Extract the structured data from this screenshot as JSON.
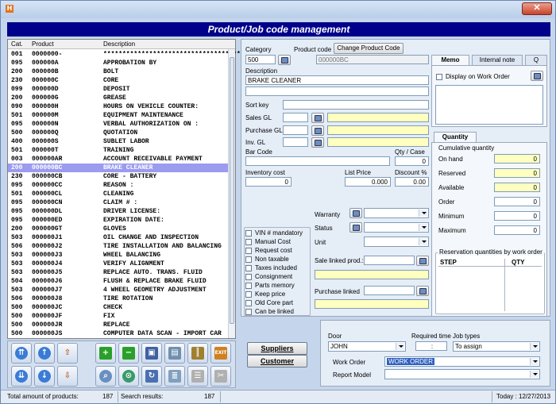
{
  "window": {
    "title": "",
    "close_glyph": "✕",
    "app_icon": "H"
  },
  "header": {
    "title": "Product/Job code management"
  },
  "list": {
    "columns": [
      "Cat.",
      "Product",
      "Description"
    ],
    "rows": [
      [
        "001",
        "0000000-",
        "**************************************"
      ],
      [
        "095",
        "000000A",
        "APPROBATION BY"
      ],
      [
        "200",
        "000000B",
        "BOLT"
      ],
      [
        "230",
        "000000C",
        "CORE"
      ],
      [
        "099",
        "000000D",
        "DEPOSIT"
      ],
      [
        "200",
        "000000G",
        "GREASE"
      ],
      [
        "090",
        "000000H",
        "HOURS ON VEHICLE COUNTER:"
      ],
      [
        "501",
        "000000M",
        "EQUIPMENT MAINTENANCE"
      ],
      [
        "095",
        "000000N",
        "VERBAL AUTHORIZATION ON :"
      ],
      [
        "500",
        "000000Q",
        "QUOTATION"
      ],
      [
        "400",
        "000000S",
        "SUBLET LABOR"
      ],
      [
        "501",
        "000000T",
        "TRAINING"
      ],
      [
        "003",
        "000000AR",
        "ACCOUNT RECEIVABLE PAYMENT"
      ],
      [
        "200",
        "000000BC",
        "BRAKE CLEANER"
      ],
      [
        "230",
        "000000CB",
        "CORE - BATTERY"
      ],
      [
        "095",
        "000000CC",
        "REASON :"
      ],
      [
        "501",
        "000000CL",
        "CLEANING"
      ],
      [
        "095",
        "000000CN",
        "CLAIM # :"
      ],
      [
        "095",
        "000000DL",
        "DRIVER LICENSE:"
      ],
      [
        "095",
        "000000ED",
        "EXPIRATION DATE:"
      ],
      [
        "200",
        "000000GT",
        "GLOVES"
      ],
      [
        "503",
        "000000J1",
        "OIL CHANGE AND INSPECTION"
      ],
      [
        "506",
        "000000J2",
        "TIRE INSTALLATION AND BALANCING"
      ],
      [
        "503",
        "000000J3",
        "WHEEL BALANCING"
      ],
      [
        "503",
        "000000J4",
        "VERIFY ALIGNMENT"
      ],
      [
        "503",
        "000000J5",
        "REPLACE AUTO. TRANS. FLUID"
      ],
      [
        "504",
        "000000J6",
        "FLUSH & REPLACE BRAKE FLUID"
      ],
      [
        "503",
        "000000J7",
        "4 WHEEL GEOMETRY ADJUSTMENT"
      ],
      [
        "506",
        "000000J8",
        "TIRE ROTATION"
      ],
      [
        "500",
        "000000JC",
        "CHECK"
      ],
      [
        "500",
        "000000JF",
        "FIX"
      ],
      [
        "500",
        "000000JR",
        "REPLACE"
      ],
      [
        "500",
        "000000JS",
        "COMPUTER DATA SCAN - IMPORT CAR"
      ]
    ],
    "selected_index": 13
  },
  "form": {
    "category_label": "Category",
    "category_value": "500",
    "product_code_label": "Product code",
    "product_code_value": "000000BC",
    "change_code_button": "Change Product Code",
    "description_label": "Description",
    "description_value": "BRAKE CLEANER",
    "sort_key_label": "Sort key",
    "sales_gl_label": "Sales GL",
    "purchase_gl_label": "Purchase GL",
    "inv_gl_label": "Inv. GL",
    "barcode_label": "Bar Code",
    "qty_case_label": "Qty / Case",
    "qty_case_value": "0",
    "inventory_cost_label": "Inventory cost",
    "inventory_cost_value": "0",
    "list_price_label": "List Price",
    "list_price_value": "0.000",
    "discount_label": "Discount %",
    "discount_value": "0.00",
    "warranty_label": "Warranty",
    "status_label": "Status",
    "unit_label": "Unit",
    "sale_linked_label": "Sale linked prod.:",
    "purchase_linked_label": "Purchase linked",
    "checkboxes": [
      "VIN # mandatory",
      "Manual Cost",
      "Request cost",
      "Non taxable",
      "Taxes included",
      "Consignment",
      "Parts memory",
      "Keep price",
      "Old Core part",
      "Can be linked"
    ]
  },
  "memo": {
    "tabs": [
      "Memo",
      "Internal note",
      "Q"
    ],
    "display_on_wo_label": "Display on Work Order"
  },
  "quantity": {
    "tab": "Quantity",
    "group_title": "Cumulative quantity",
    "rows": [
      {
        "label": "On hand",
        "value": "0"
      },
      {
        "label": "Reserved",
        "value": "0"
      },
      {
        "label": "Available",
        "value": "0"
      },
      {
        "label": "Order",
        "value": "0"
      },
      {
        "label": "Minimum",
        "value": "0"
      },
      {
        "label": "Maximum",
        "value": "0"
      }
    ],
    "reservation_title": "Reservation quantities by work order",
    "reservation_cols": [
      "STEP",
      "QTY"
    ]
  },
  "buttons": {
    "suppliers": "Suppliers",
    "customer": "Customer"
  },
  "bottom": {
    "door_label": "Door",
    "door_value": "JOHN",
    "required_time_label": "Required time",
    "required_time_value": ":",
    "job_types_label": "Job types",
    "job_types_value": "To assign",
    "work_order_label": "Work Order",
    "work_order_value": "WORK ORDER",
    "report_model_label": "Report Model"
  },
  "status": {
    "total_label": "Total amount of products:",
    "total_value": "187",
    "search_label": "Search results:",
    "search_value": "187",
    "today": "Today : 12/27/2013"
  },
  "icons": [
    "exit-icon"
  ],
  "colors": {
    "header_bg": "#00008a",
    "selected_row": "#9b9bf0",
    "yellow_field": "#ffffc0"
  }
}
